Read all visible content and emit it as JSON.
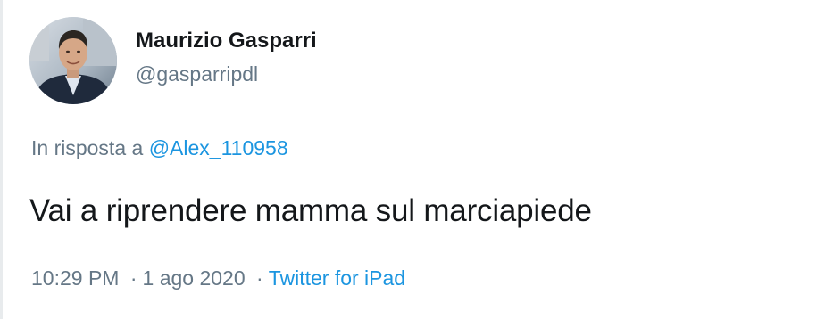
{
  "tweet": {
    "author": {
      "display_name": "Maurizio Gasparri",
      "handle": "@gasparripdl"
    },
    "reply": {
      "prefix": "In risposta a",
      "to_handle": "@Alex_110958"
    },
    "text": "Vai a riprendere mamma sul marciapiede",
    "meta": {
      "time": "10:29 PM",
      "separator": "·",
      "date": "1 ago 2020",
      "source": "Twitter for iPad"
    }
  },
  "colors": {
    "text": "#14171a",
    "secondary": "#657786",
    "link": "#1b95e0"
  },
  "icons": {
    "avatar": "profile-photo"
  }
}
